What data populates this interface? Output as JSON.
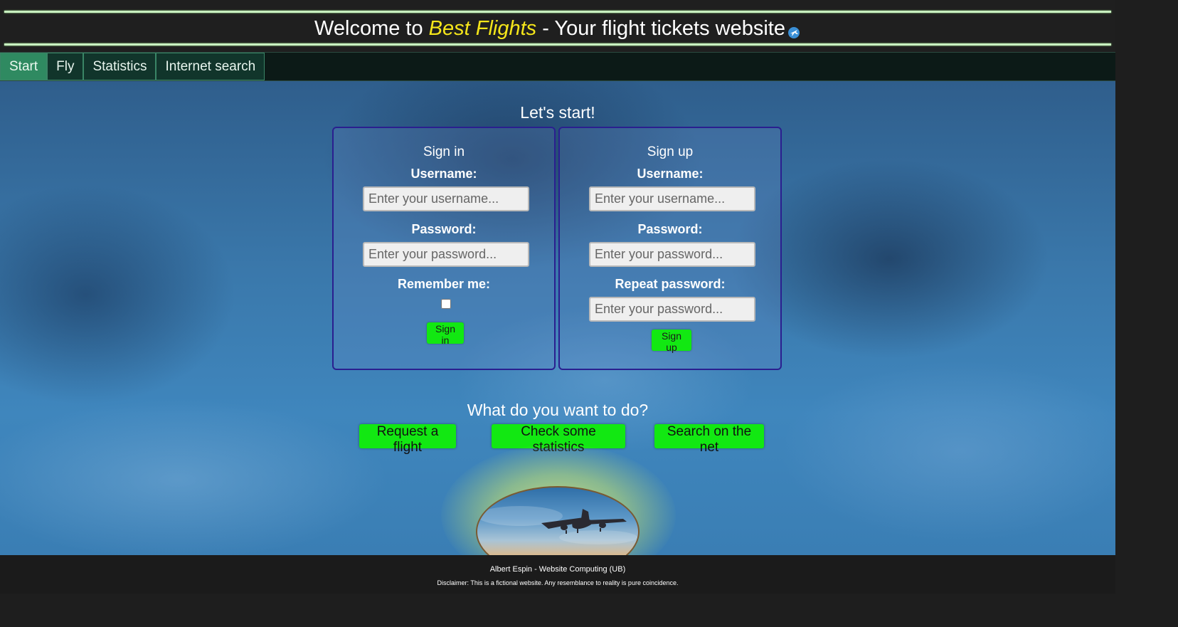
{
  "header": {
    "title_prefix": "Welcome to",
    "brand": "Best Flights",
    "title_suffix": "- Your flight tickets website",
    "icon": "plane-icon"
  },
  "nav": {
    "tabs": [
      {
        "label": "Start",
        "active": true
      },
      {
        "label": "Fly",
        "active": false
      },
      {
        "label": "Statistics",
        "active": false
      },
      {
        "label": "Internet search",
        "active": false
      }
    ]
  },
  "main": {
    "heading": "Let's start!",
    "signin": {
      "title": "Sign in",
      "username_label": "Username:",
      "username_placeholder": "Enter your username...",
      "password_label": "Password:",
      "password_placeholder": "Enter your password...",
      "remember_label": "Remember me:",
      "remember_checked": false,
      "button": "Sign in"
    },
    "signup": {
      "title": "Sign up",
      "username_label": "Username:",
      "username_placeholder": "Enter your username...",
      "password_label": "Password:",
      "password_placeholder": "Enter your password...",
      "repeat_label": "Repeat password:",
      "repeat_placeholder": "Enter your password...",
      "button": "Sign up"
    },
    "todo_heading": "What do you want to do?",
    "actions": {
      "request": "Request a flight",
      "stats": "Check some statistics",
      "search": "Search on the net"
    }
  },
  "footer": {
    "credit": "Albert Espin - Website Computing (UB)",
    "disclaimer": "Disclaimer: This is a fictional website. Any resemblance to reality is pure coincidence."
  },
  "colors": {
    "brand": "#f5e61a",
    "button": "#12e812",
    "nav_active": "#2f8a61",
    "panel_border": "#2a1f8f"
  }
}
